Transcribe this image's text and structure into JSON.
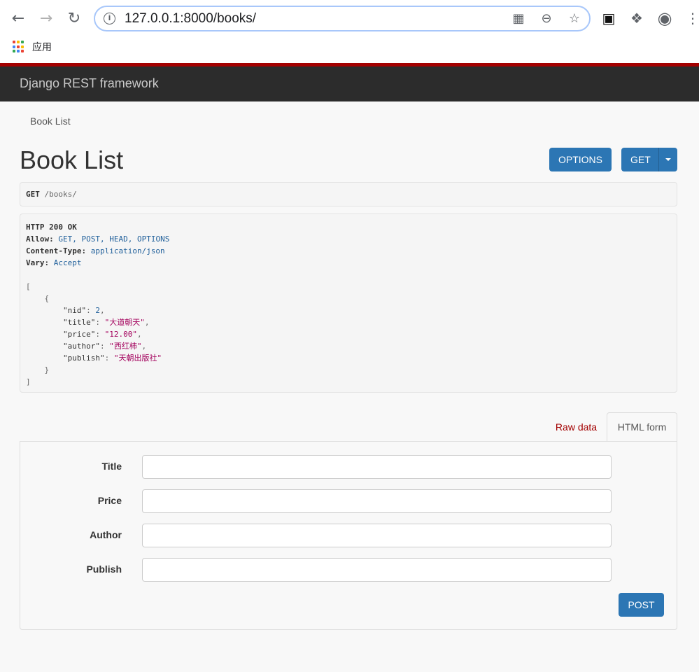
{
  "browser": {
    "url_host": "127.0.0.1",
    "url_rest": ":8000/books/",
    "bookmark_label": "应用",
    "back_icon": "back-arrow-icon",
    "forward_icon": "forward-arrow-icon",
    "reload_icon": "reload-icon"
  },
  "navbar": {
    "brand": "Django REST framework"
  },
  "breadcrumb": {
    "item": "Book List"
  },
  "page": {
    "title": "Book List"
  },
  "actions": {
    "options": "OPTIONS",
    "get": "GET"
  },
  "request": {
    "method": "GET",
    "path": "/books/"
  },
  "response": {
    "status_line": "HTTP 200 OK",
    "headers": [
      {
        "name": "Allow:",
        "value": "GET, POST, HEAD, OPTIONS"
      },
      {
        "name": "Content-Type:",
        "value": "application/json"
      },
      {
        "name": "Vary:",
        "value": "Accept"
      }
    ],
    "body": {
      "open_bracket": "[",
      "open_brace": "{",
      "fields": [
        {
          "key": "\"nid\"",
          "value": "2",
          "kind": "num",
          "comma": ","
        },
        {
          "key": "\"title\"",
          "value": "\"大道朝天\"",
          "kind": "str",
          "comma": ","
        },
        {
          "key": "\"price\"",
          "value": "\"12.00\"",
          "kind": "str",
          "comma": ","
        },
        {
          "key": "\"author\"",
          "value": "\"西红柿\"",
          "kind": "str",
          "comma": ","
        },
        {
          "key": "\"publish\"",
          "value": "\"天朝出版社\"",
          "kind": "str",
          "comma": ""
        }
      ],
      "close_brace": "}",
      "close_bracket": "]"
    }
  },
  "form_tabs": {
    "raw": "Raw data",
    "html": "HTML form"
  },
  "form": {
    "fields": [
      {
        "label": "Title",
        "value": ""
      },
      {
        "label": "Price",
        "value": ""
      },
      {
        "label": "Author",
        "value": ""
      },
      {
        "label": "Publish",
        "value": ""
      }
    ],
    "submit": "POST"
  },
  "colors": {
    "accent_red": "#a30000",
    "button_blue": "#2c76b4",
    "navbar_bg": "#2c2c2c"
  }
}
